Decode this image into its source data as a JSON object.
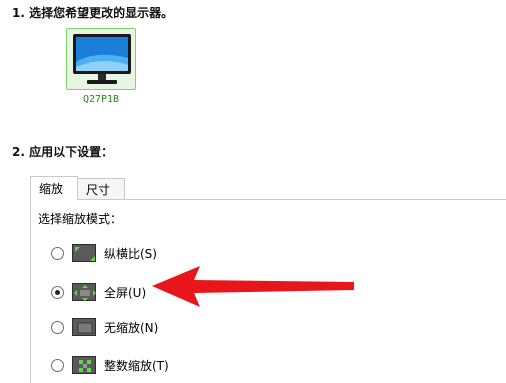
{
  "steps": {
    "select_display": "1. 选择您希望更改的显示器。",
    "apply_settings": "2. 应用以下设置："
  },
  "display": {
    "name": "Q27P1B"
  },
  "tabs": [
    {
      "label": "缩放"
    },
    {
      "label": "尺寸"
    }
  ],
  "scaling": {
    "caption": "选择缩放模式：",
    "options": [
      {
        "label": "纵横比(S)",
        "checked": false
      },
      {
        "label": "全屏(U)",
        "checked": true
      },
      {
        "label": "无缩放(N)",
        "checked": false
      },
      {
        "label": "整数缩放(T)",
        "checked": false
      }
    ]
  },
  "colors": {
    "selected_tile_border": "#7fd36a",
    "monitor_label": "#208a20",
    "annotation_arrow": "#e8161a"
  },
  "icons": [
    "monitor-icon",
    "aspect-ratio-icon",
    "full-screen-icon",
    "no-scaling-icon",
    "integer-scaling-icon"
  ]
}
